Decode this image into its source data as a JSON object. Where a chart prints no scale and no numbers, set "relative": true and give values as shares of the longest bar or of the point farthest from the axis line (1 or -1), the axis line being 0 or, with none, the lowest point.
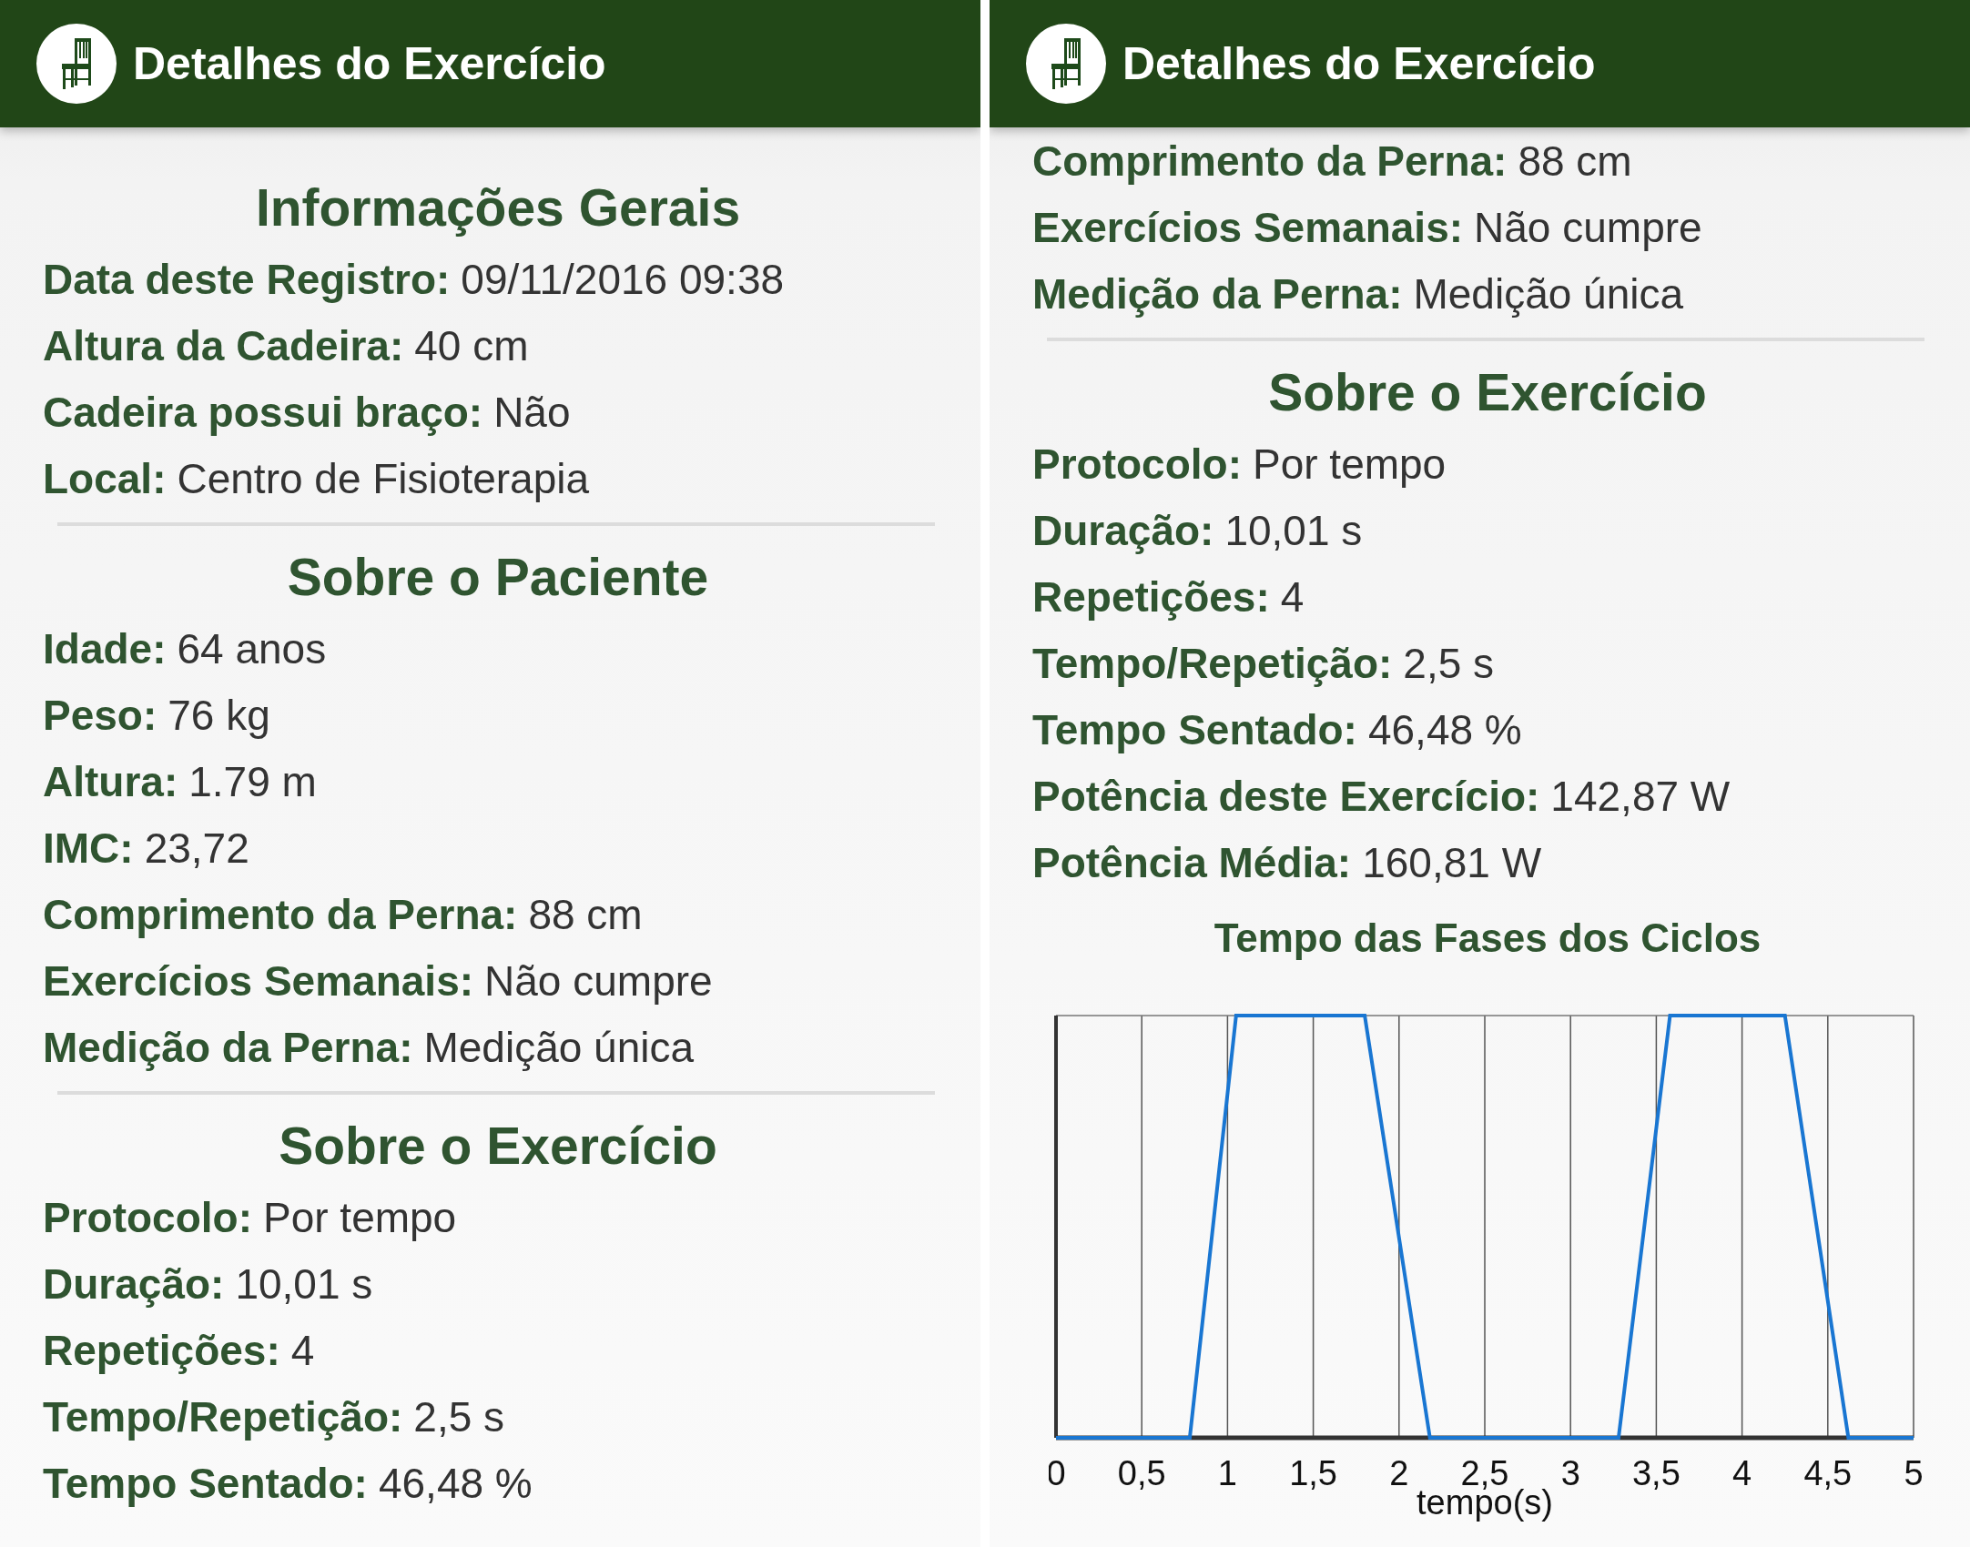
{
  "panels": [
    {
      "header": {
        "title": "Detalhes do Exercício"
      },
      "sections": [
        {
          "heading": "Informações Gerais",
          "rows": [
            {
              "label": "Data deste Registro:",
              "value": "09/11/2016 09:38"
            },
            {
              "label": "Altura da Cadeira:",
              "value": "40 cm"
            },
            {
              "label": "Cadeira possui braço:",
              "value": "Não"
            },
            {
              "label": "Local:",
              "value": "Centro de Fisioterapia"
            }
          ]
        },
        {
          "heading": "Sobre o Paciente",
          "rows": [
            {
              "label": "Idade:",
              "value": "64 anos"
            },
            {
              "label": "Peso:",
              "value": "76 kg"
            },
            {
              "label": "Altura:",
              "value": "1.79 m"
            },
            {
              "label": "IMC:",
              "value": "23,72"
            },
            {
              "label": "Comprimento da Perna:",
              "value": "88 cm"
            },
            {
              "label": "Exercícios Semanais:",
              "value": "Não cumpre"
            },
            {
              "label": "Medição da Perna:",
              "value": "Medição única"
            }
          ]
        },
        {
          "heading": "Sobre o Exercício",
          "rows": [
            {
              "label": "Protocolo:",
              "value": "Por tempo"
            },
            {
              "label": "Duração:",
              "value": "10,01 s"
            },
            {
              "label": "Repetições:",
              "value": "4"
            },
            {
              "label": "Tempo/Repetição:",
              "value": "2,5 s"
            },
            {
              "label": "Tempo Sentado:",
              "value": "46,48 %"
            }
          ]
        }
      ]
    },
    {
      "header": {
        "title": "Detalhes do Exercício"
      },
      "sections": [
        {
          "rows": [
            {
              "label": "Comprimento da Perna:",
              "value": "88 cm"
            },
            {
              "label": "Exercícios Semanais:",
              "value": "Não cumpre"
            },
            {
              "label": "Medição da Perna:",
              "value": "Medição única"
            }
          ]
        },
        {
          "heading": "Sobre o Exercício",
          "rows": [
            {
              "label": "Protocolo:",
              "value": "Por tempo"
            },
            {
              "label": "Duração:",
              "value": "10,01 s"
            },
            {
              "label": "Repetições:",
              "value": "4"
            },
            {
              "label": "Tempo/Repetição:",
              "value": "2,5 s"
            },
            {
              "label": "Tempo Sentado:",
              "value": "46,48 %"
            },
            {
              "label": "Potência deste Exercício:",
              "value": "142,87 W"
            },
            {
              "label": "Potência Média:",
              "value": "160,81 W"
            }
          ],
          "chart_data": {
            "type": "line",
            "title": "Tempo das Fases dos Ciclos",
            "xlabel": "tempo(s)",
            "x": [
              0,
              0.78,
              1.05,
              1.8,
              2.18,
              3.28,
              3.58,
              4.25,
              4.62,
              5
            ],
            "series": [
              {
                "color": "#1976d2",
                "values": [
                  0,
                  0,
                  1,
                  1,
                  0,
                  0,
                  1,
                  1,
                  0,
                  0
                ]
              }
            ],
            "relative": true,
            "grid": true,
            "xlim": [
              0,
              5
            ],
            "xticks": [
              {
                "value": 0,
                "label": "0"
              },
              {
                "value": 0.5,
                "label": "0,5"
              },
              {
                "value": 1,
                "label": "1"
              },
              {
                "value": 1.5,
                "label": "1,5"
              },
              {
                "value": 2,
                "label": "2"
              },
              {
                "value": 2.5,
                "label": "2,5"
              },
              {
                "value": 3,
                "label": "3"
              },
              {
                "value": 3.5,
                "label": "3,5"
              },
              {
                "value": 4,
                "label": "4"
              },
              {
                "value": 4.5,
                "label": "4,5"
              },
              {
                "value": 5,
                "label": "5"
              }
            ]
          }
        }
      ]
    }
  ]
}
